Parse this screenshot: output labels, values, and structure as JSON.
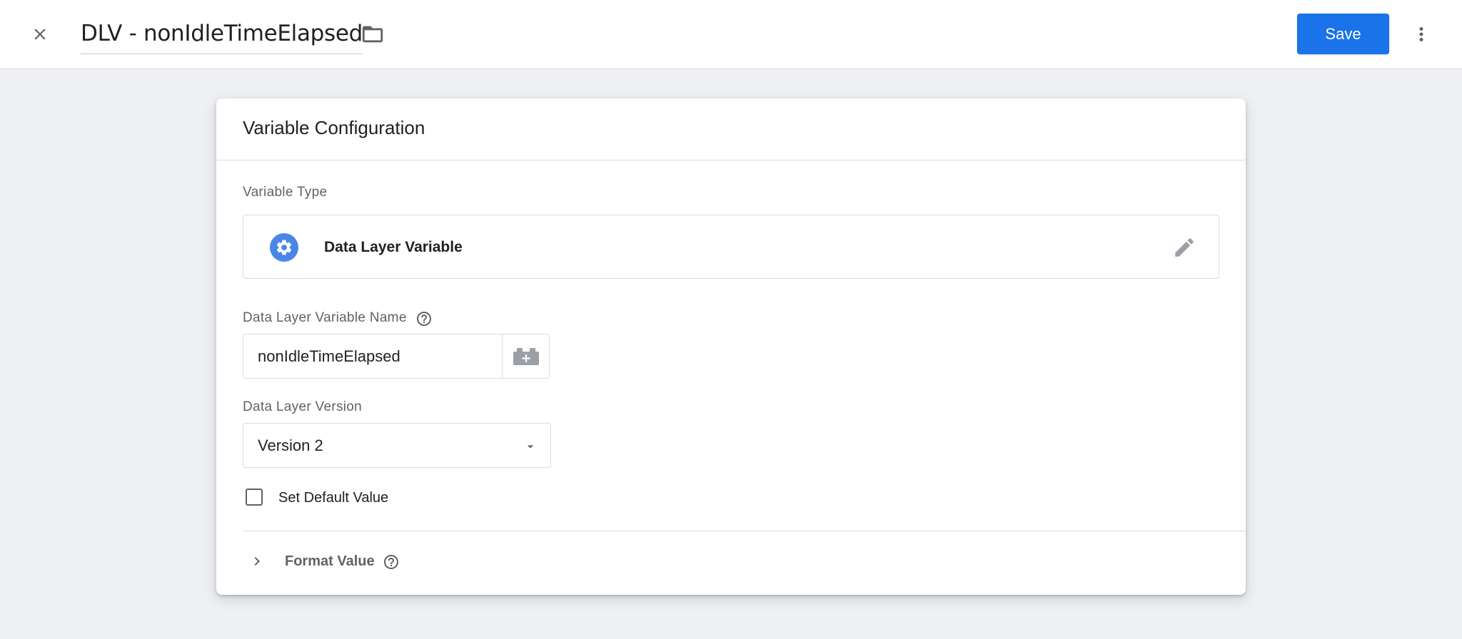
{
  "header": {
    "close_icon": "close-icon",
    "title": "DLV - nonIdleTimeElapsed",
    "folder_icon": "folder-icon",
    "save_label": "Save",
    "more_icon": "more-vert-icon",
    "accent_color": "#1a73e8"
  },
  "card": {
    "title": "Variable Configuration",
    "variable_type": {
      "label": "Variable Type",
      "name": "Data Layer Variable",
      "icon": "gear-icon",
      "edit_icon": "pencil-icon"
    },
    "dlv_name": {
      "label": "Data Layer Variable Name",
      "value": "nonIdleTimeElapsed",
      "help_icon": "help-icon",
      "picker_icon": "variable-picker-icon"
    },
    "dl_version": {
      "label": "Data Layer Version",
      "selected": "Version 2"
    },
    "default_value": {
      "label": "Set Default Value",
      "checked": false
    },
    "format_value": {
      "label": "Format Value",
      "expanded": false
    }
  }
}
